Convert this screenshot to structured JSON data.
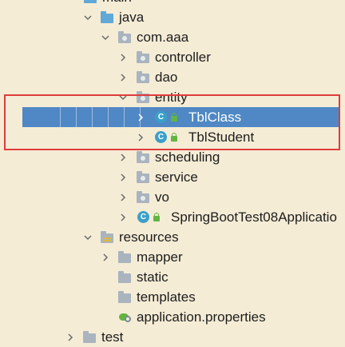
{
  "tree": {
    "rows": [
      {
        "label": "main"
      },
      {
        "label": "java"
      },
      {
        "label": "com.aaa"
      },
      {
        "label": "controller"
      },
      {
        "label": "dao"
      },
      {
        "label": "entity"
      },
      {
        "label": "TblClass"
      },
      {
        "label": "TblStudent"
      },
      {
        "label": "scheduling"
      },
      {
        "label": "service"
      },
      {
        "label": "vo"
      },
      {
        "label": "SpringBootTest08Applicatio"
      },
      {
        "label": "resources"
      },
      {
        "label": "mapper"
      },
      {
        "label": "static"
      },
      {
        "label": "templates"
      },
      {
        "label": "application.properties"
      },
      {
        "label": "test"
      }
    ],
    "class_icon_letter": "C",
    "selected": "TblClass"
  },
  "colors": {
    "background": "#f5ecd6",
    "selection": "#4f88c4",
    "highlight_border": "#e03c3c",
    "source_folder": "#5fa8d8"
  }
}
